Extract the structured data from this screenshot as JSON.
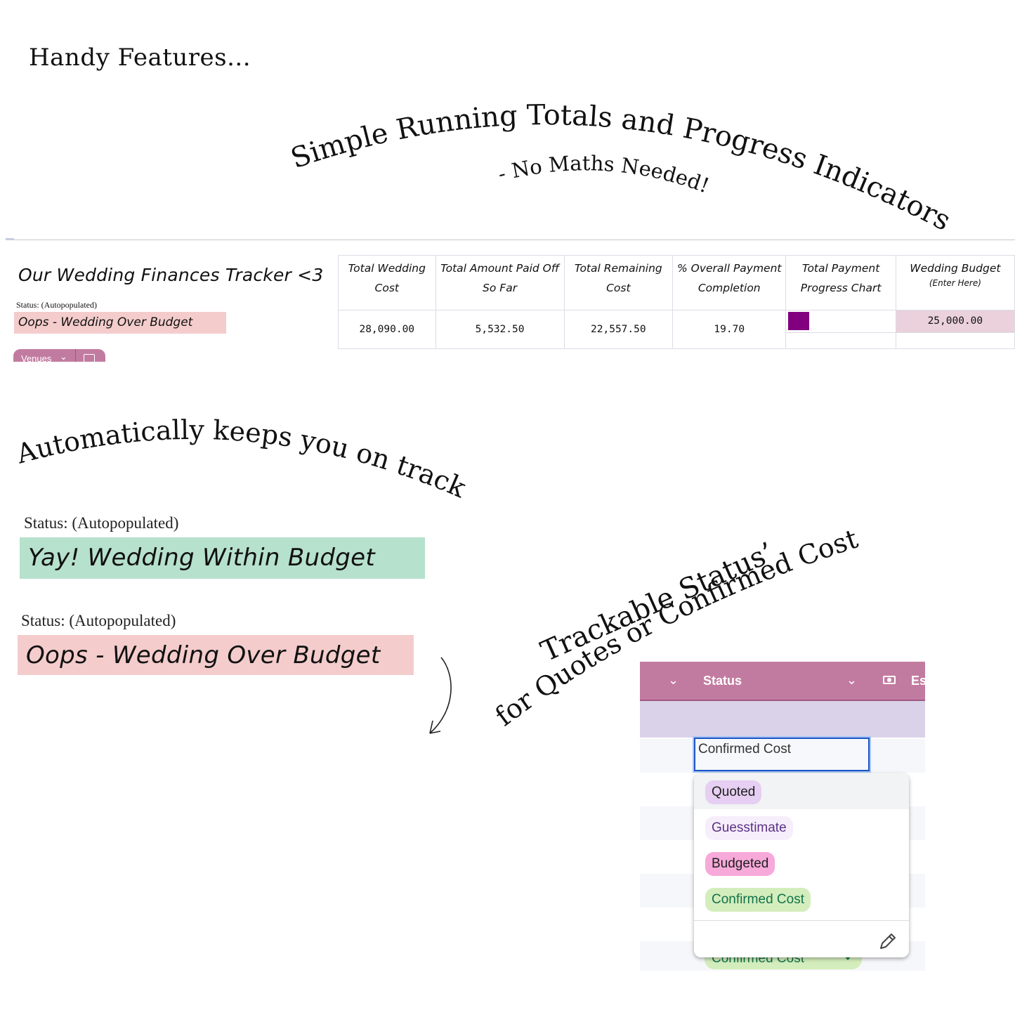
{
  "headings": {
    "handy": "Handy Features...",
    "running_totals": "Simple Running Totals and Progress Indicators",
    "no_maths": "- No Maths Needed!",
    "on_track": "Automatically keeps you on track",
    "trackable_line1": "Trackable Status’",
    "trackable_line2": "for Quotes or Confirmed Costs"
  },
  "tracker": {
    "title": "Our Wedding Finances Tracker <3",
    "status_label": "Status: (Autopopulated)",
    "status_value": "Oops - Wedding Over Budget",
    "status_color": "#f4cccc",
    "sheet_tab": "Venues",
    "totals": [
      {
        "header_line1": "Total Wedding",
        "header_line2": "Cost",
        "value": "28,090.00"
      },
      {
        "header_line1": "Total Amount Paid Off",
        "header_line2": "So Far",
        "value": "5,532.50"
      },
      {
        "header_line1": "Total Remaining",
        "header_line2": "Cost",
        "value": "22,557.50"
      },
      {
        "header_line1": "% Overall Payment",
        "header_line2": "Completion",
        "value": "19.70"
      },
      {
        "header_line1": "Total Payment",
        "header_line2": "Progress Chart",
        "progress_percent": 19.7,
        "bar_color": "#800080"
      },
      {
        "header_line1": "Wedding Budget",
        "header_sub": "(Enter Here)",
        "value": "25,000.00",
        "cell_color": "#ead1dc"
      }
    ]
  },
  "status_examples": [
    {
      "label": "Status: (Autopopulated)",
      "value": "Yay! Wedding Within Budget",
      "color": "#b6e1cd"
    },
    {
      "label": "Status: (Autopopulated)",
      "value": "Oops - Wedding Over Budget",
      "color": "#f4cccc"
    }
  ],
  "status_dropdown": {
    "column_header": "Status",
    "next_column_partial": "Es",
    "header_color": "#c27ba0",
    "current_value": "Confirmed Cost",
    "options": [
      {
        "label": "Quoted",
        "bg": "#e6cff2",
        "fg": "#1f1f1f",
        "highlighted": true
      },
      {
        "label": "Guesstimate",
        "bg": "#f7eefb",
        "fg": "#5a3286",
        "highlighted": false
      },
      {
        "label": "Budgeted",
        "bg": "#f7a9d9",
        "fg": "#1f1f1f",
        "highlighted": false
      },
      {
        "label": "Confirmed Cost",
        "bg": "#d4edbc",
        "fg": "#11734b",
        "highlighted": false
      }
    ],
    "underlying_chip": "Confirmed Cost"
  }
}
